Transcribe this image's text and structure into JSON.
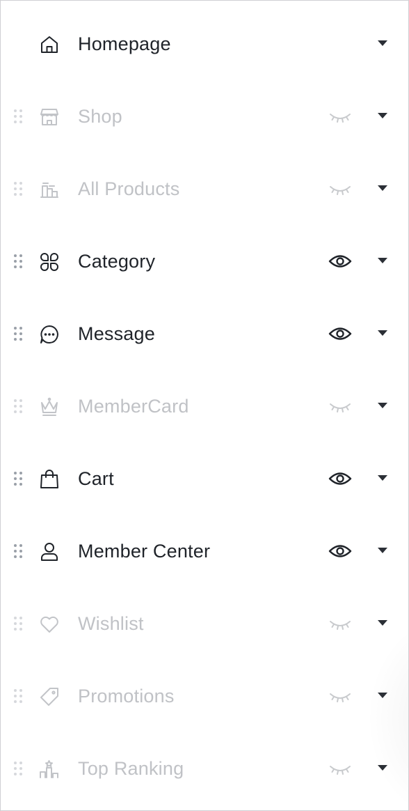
{
  "menu": {
    "items": [
      {
        "label": "Homepage",
        "icon": "home-icon",
        "visible": true,
        "draggable": false
      },
      {
        "label": "Shop",
        "icon": "shop-icon",
        "visible": false,
        "draggable": true
      },
      {
        "label": "All Products",
        "icon": "all-products-icon",
        "visible": false,
        "draggable": true
      },
      {
        "label": "Category",
        "icon": "category-icon",
        "visible": true,
        "draggable": true
      },
      {
        "label": "Message",
        "icon": "message-icon",
        "visible": true,
        "draggable": true
      },
      {
        "label": "MemberCard",
        "icon": "crown-icon",
        "visible": false,
        "draggable": true
      },
      {
        "label": "Cart",
        "icon": "shopping-bag-icon",
        "visible": true,
        "draggable": true
      },
      {
        "label": "Member Center",
        "icon": "user-icon",
        "visible": true,
        "draggable": true
      },
      {
        "label": "Wishlist",
        "icon": "heart-icon",
        "visible": false,
        "draggable": true
      },
      {
        "label": "Promotions",
        "icon": "tag-icon",
        "visible": false,
        "draggable": true
      },
      {
        "label": "Top Ranking",
        "icon": "ranking-icon",
        "visible": false,
        "draggable": true
      }
    ]
  },
  "colors": {
    "text": "#1f2329",
    "text_disabled": "#c0c2c6",
    "eye_visible": "#1f2329",
    "eye_hidden": "#c8cacd",
    "caret": "#2b2f36"
  }
}
